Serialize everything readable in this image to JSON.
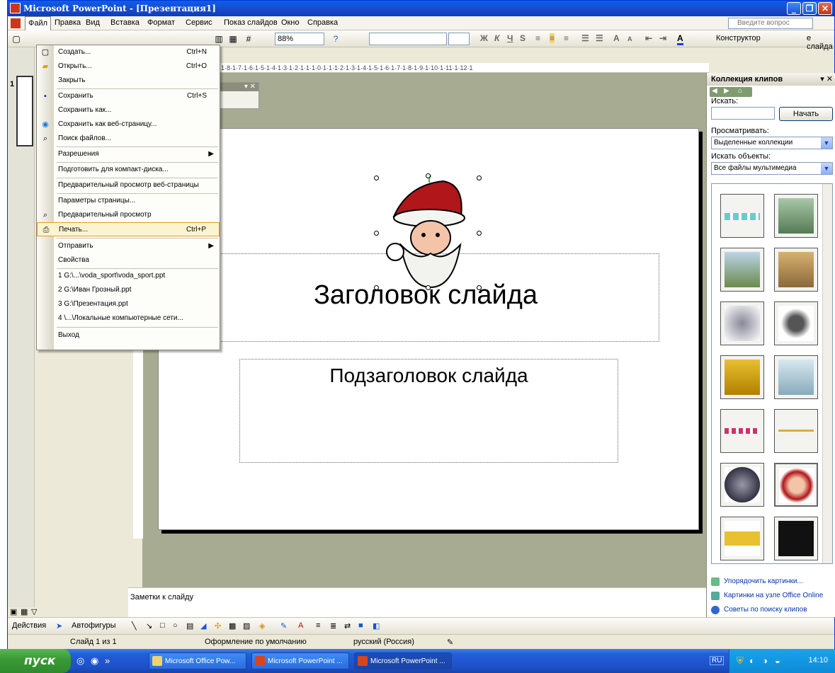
{
  "window": {
    "title": "Microsoft PowerPoint - [Презентация1]",
    "controls": [
      "_",
      "❐",
      "✕"
    ]
  },
  "menubar": {
    "items": [
      "Файл",
      "Правка",
      "Вид",
      "Вставка",
      "Формат",
      "Сервис",
      "Показ слайдов",
      "Окно",
      "Справка"
    ],
    "help_placeholder": "Введите вопрос"
  },
  "toolbar": {
    "zoom": "88%",
    "constructor_label": "Конструктор",
    "slide_label": "е слайда"
  },
  "ruler": {
    "text": "·9·1·8·1·7·1·6·1·5·1·4·1·3·1·2·1·1·1·0·1·1·1·2·1·3·1·4·1·5·1·6·1·7·1·8·1·9·1·10·1·11·1·12·1"
  },
  "file_menu": {
    "items": [
      {
        "label": "Создать...",
        "shortcut": "Ctrl+N"
      },
      {
        "label": "Открыть...",
        "shortcut": "Ctrl+O"
      },
      {
        "label": "Закрыть",
        "shortcut": ""
      },
      {
        "label": "Сохранить",
        "shortcut": "Ctrl+S"
      },
      {
        "label": "Сохранить как...",
        "shortcut": ""
      },
      {
        "label": "Сохранить как веб-страницу...",
        "shortcut": ""
      },
      {
        "label": "Поиск файлов...",
        "shortcut": ""
      },
      {
        "label": "Разрешения",
        "shortcut": ""
      },
      {
        "label": "Подготовить для компакт-диска...",
        "shortcut": ""
      },
      {
        "label": "Предварительный просмотр веб-страницы",
        "shortcut": ""
      },
      {
        "label": "Параметры страницы...",
        "shortcut": ""
      },
      {
        "label": "Предварительный просмотр",
        "shortcut": ""
      },
      {
        "label": "Печать...",
        "shortcut": "Ctrl+P"
      },
      {
        "label": "Отправить",
        "shortcut": ""
      },
      {
        "label": "Свойства",
        "shortcut": ""
      },
      {
        "label": "1 G:\\...\\voda_sport\\voda_sport.ppt",
        "shortcut": ""
      },
      {
        "label": "2 G:\\Иван Грозный.ppt",
        "shortcut": ""
      },
      {
        "label": "3 G:\\Презентация.ppt",
        "shortcut": ""
      },
      {
        "label": "4 \\...\\Локальные компьютерные сети...",
        "shortcut": ""
      },
      {
        "label": "Выход",
        "shortcut": ""
      }
    ]
  },
  "thumbnail": {
    "number": "1"
  },
  "slide": {
    "title": "Заголовок слайда",
    "subtitle": "Подзаголовок слайда"
  },
  "notes": {
    "placeholder": "Заметки к слайду"
  },
  "drawing_toolbar": {
    "actions_label": "Действия",
    "autoshapes_label": "Автофигуры"
  },
  "statusbar": {
    "slide_info": "Слайд 1 из 1",
    "design": "Оформление по умолчанию",
    "language": "русский (Россия)"
  },
  "task_pane": {
    "title": "Коллекция клипов",
    "search_label": "Искать:",
    "search_button": "Начать",
    "browse_label": "Просматривать:",
    "browse_value": "Выделенные коллекции",
    "find_label": "Искать объекты:",
    "find_value": "Все файлы мультимедиа",
    "clips": [
      "border-1",
      "man-with-camera",
      "landscape",
      "autumn-tree",
      "skier",
      "cow",
      "bulldozer",
      "eiffel-tower",
      "border-2",
      "border-3",
      "football-helmet",
      "santa",
      "school-bus",
      "house"
    ],
    "links": [
      "Упорядочить картинки...",
      "Картинки на узле Office Online",
      "Советы по поиску клипов"
    ]
  },
  "taskbar": {
    "start_label": "пуск",
    "tasks": [
      "Microsoft Office Pow...",
      "Microsoft PowerPoint ...",
      "Microsoft PowerPoint ..."
    ],
    "lang": "RU",
    "clock": "14:10"
  },
  "colors": {
    "titlebar": "#0a5fe8",
    "edit_area": "#a6ab92",
    "start_button": "#3b9a37"
  }
}
